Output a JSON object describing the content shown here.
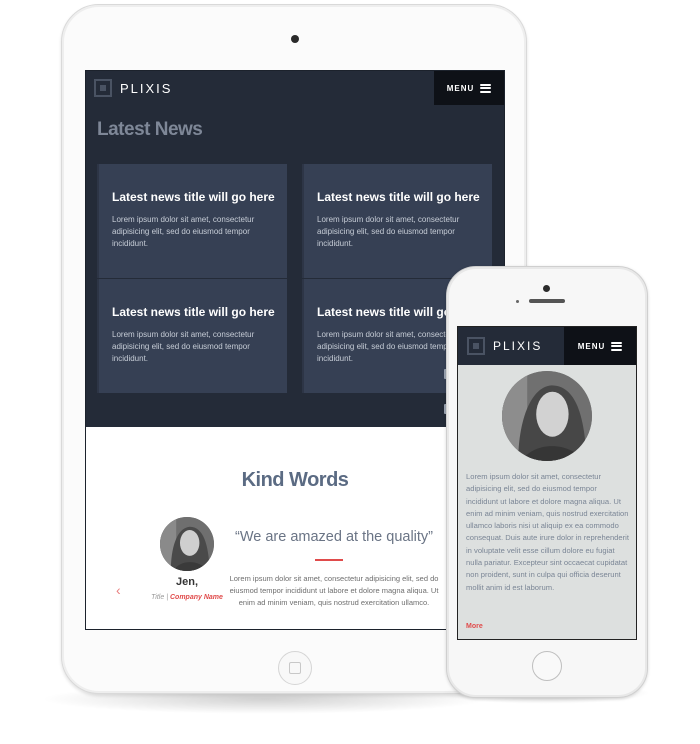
{
  "brand": {
    "name": "PLIXIS",
    "menu_label": "MENU"
  },
  "colors": {
    "dark_bg": "#242b38",
    "card_bg": "#364054",
    "accent": "#e04b4b",
    "phone_bg": "#dde0df"
  },
  "tablet": {
    "heading": "Latest News",
    "news": [
      {
        "title": "Latest news title will go here",
        "body": "Lorem ipsum dolor sit amet, consectetur adipisicing elit, sed do eiusmod tempor incididunt."
      },
      {
        "title": "Latest news title will go here",
        "body": "Lorem ipsum dolor sit amet, consectetur adipisicing elit, sed do eiusmod tempor incididunt."
      },
      {
        "title": "Latest news title will go here",
        "body": "Lorem ipsum dolor sit amet, consectetur adipisicing elit, sed do eiusmod tempor incididunt."
      },
      {
        "title": "Latest news title will go here",
        "body": "Lorem ipsum dolor sit amet, consectetur adipisicing elit, sed do eiusmod tempor incididunt."
      }
    ],
    "testimonials": {
      "heading": "Kind Words",
      "name": "Jen,",
      "title": "Title",
      "separator": "|",
      "company": "Company Name",
      "prev_icon": "chevron-left-icon",
      "prev_glyph": "‹",
      "quote": "“We are amazed at the quality”",
      "body": "Lorem ipsum dolor sit amet, consectetur adipisicing elit, sed do eiusmod tempor incididunt ut labore et dolore magna aliqua. Ut enim ad minim veniam, quis nostrud exercitation ullamco."
    }
  },
  "phone": {
    "body": "Lorem ipsum dolor sit amet, consectetur adipisicing elit, sed do eiusmod tempor incididunt ut labore et dolore magna aliqua. Ut enim ad minim veniam, quis nostrud exercitation ullamco laboris nisi ut aliquip ex ea commodo consequat. Duis aute irure dolor in reprehenderit in voluptate velit esse cillum dolore eu fugiat nulla pariatur. Excepteur sint occaecat cupidatat non proident, sunt in culpa qui officia deserunt mollit anim id est laborum.",
    "more_label": "More"
  }
}
